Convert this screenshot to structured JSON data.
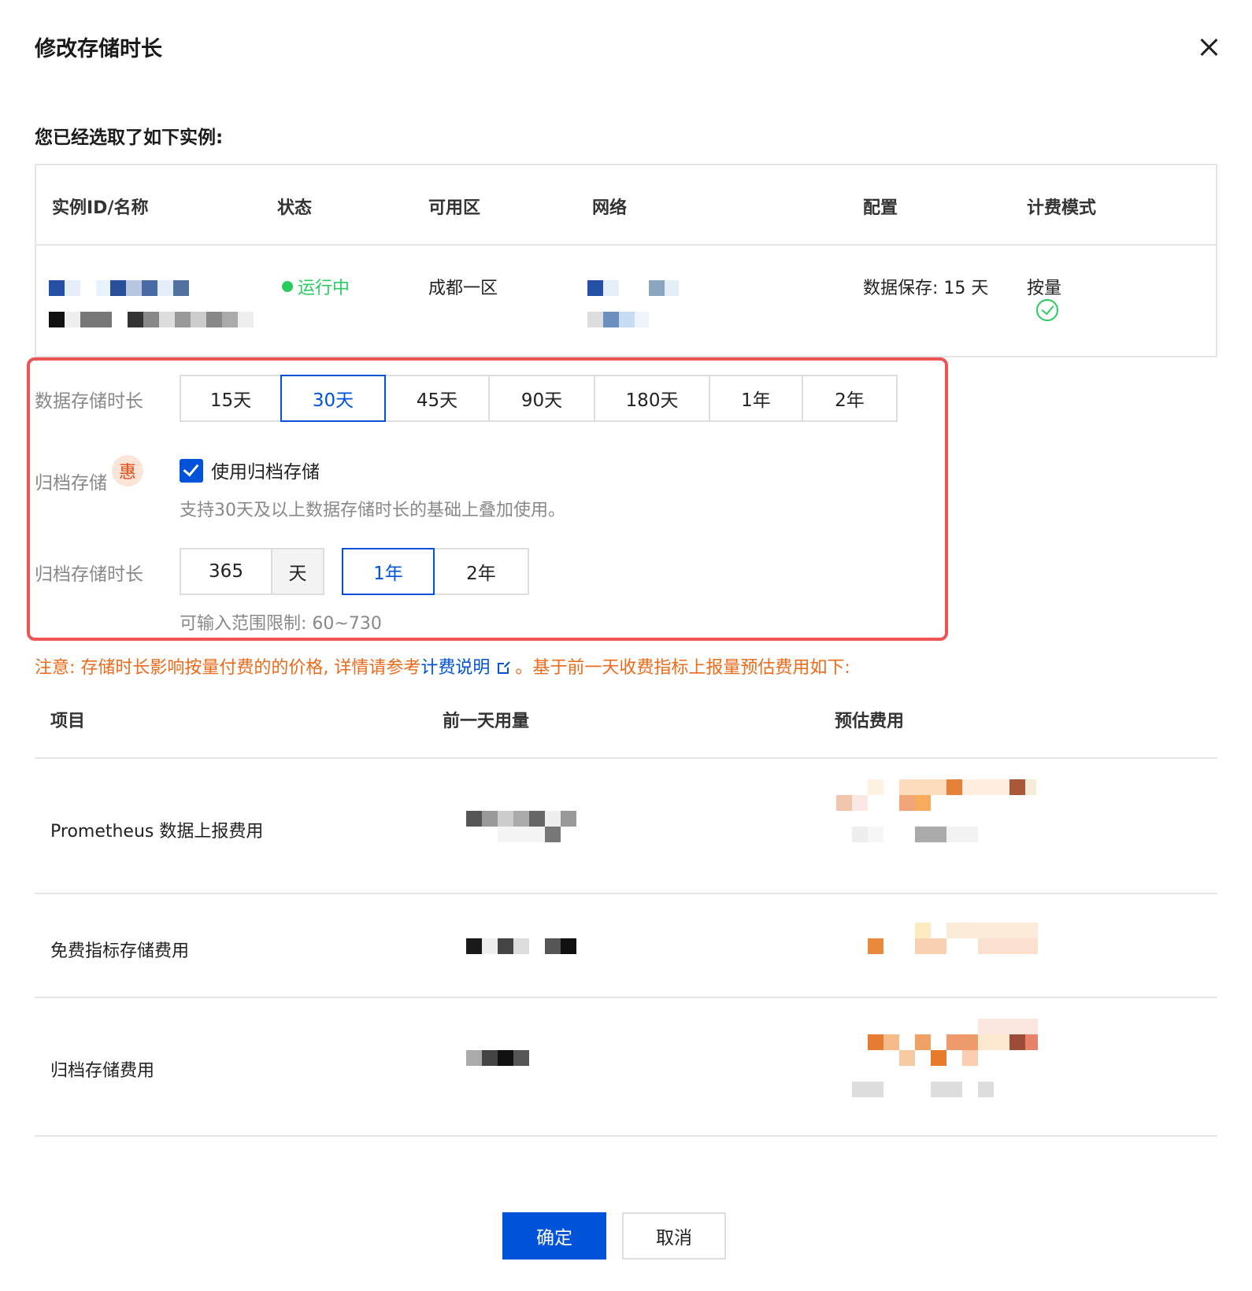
{
  "dialog": {
    "title": "修改存储时长",
    "subtitle": "您已经选取了如下实例:"
  },
  "instance_table": {
    "headers": [
      "实例ID/名称",
      "状态",
      "可用区",
      "网络",
      "配置",
      "计费模式"
    ],
    "row": {
      "status": "运行中",
      "zone": "成都一区",
      "config": "数据保存: 15 天",
      "billing": "按量"
    },
    "colors": {
      "status": "#29cc5f"
    }
  },
  "storage": {
    "duration_label": "数据存储时长",
    "duration_options": [
      "15天",
      "30天",
      "45天",
      "90天",
      "180天",
      "1年",
      "2年"
    ],
    "duration_selected": "30天",
    "archive_label": "归档存储",
    "archive_badge": "惠",
    "archive_checkbox_label": "使用归档存储",
    "archive_checked": true,
    "archive_hint": "支持30天及以上数据存储时长的基础上叠加使用。",
    "archive_duration_label": "归档存储时长",
    "archive_days_value": "365",
    "archive_unit": "天",
    "archive_duration_options": [
      "1年",
      "2年"
    ],
    "archive_duration_selected": "1年",
    "archive_range_hint": "可输入范围限制: 60~730"
  },
  "notice": {
    "prefix": "注意: 存储时长影响按量付费的的价格, 详情请参考",
    "link": "计费说明",
    "suffix": "。基于前一天收费指标上报量预估费用如下:"
  },
  "cost_table": {
    "headers": [
      "项目",
      "前一天用量",
      "预估费用"
    ],
    "rows": [
      "Prometheus 数据上报费用",
      "免费指标存储费用",
      "归档存储费用"
    ]
  },
  "footer": {
    "confirm": "确定",
    "cancel": "取消"
  },
  "colors": {
    "primary": "#0052d9",
    "warning": "#ec6a1a",
    "highlight_border": "#ef5454"
  }
}
